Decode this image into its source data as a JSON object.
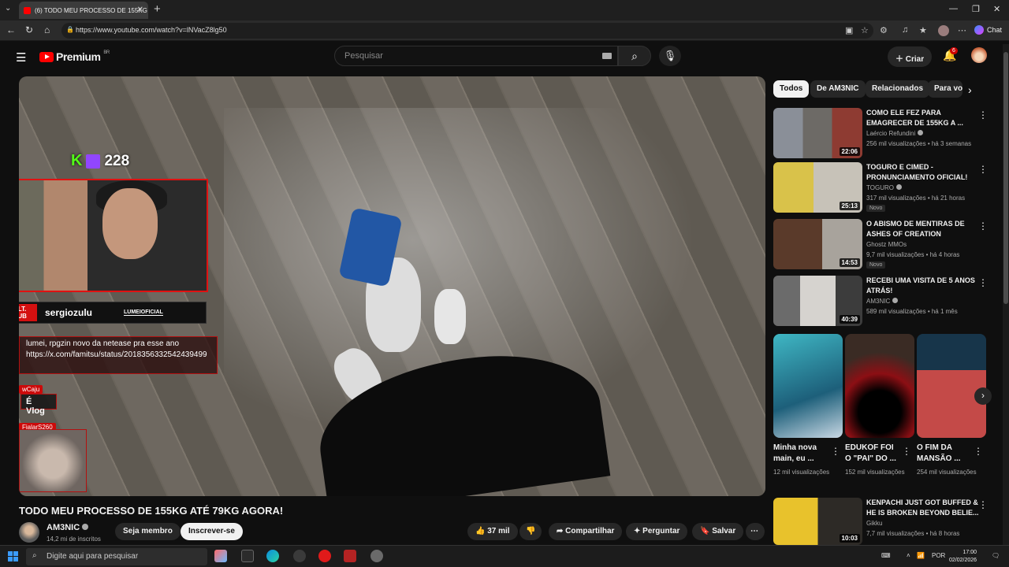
{
  "browser": {
    "tab_title": "(6) TODO MEU PROCESSO DE 155KG",
    "url": "https://www.youtube.com/watch?v=lNVacZ8lg50",
    "chat_label": "Chat"
  },
  "header": {
    "logo_text": "Premium",
    "logo_region": "BR",
    "search_placeholder": "Pesquisar",
    "create_label": "Criar",
    "notif_count": "6"
  },
  "overlay": {
    "counter": "228",
    "ult_label": "ULT. SUB",
    "username": "sergiozulu",
    "brand": "LUMEIOFICIAL",
    "msg1": "lumei, rpgzin novo da netease pra esse ano https://x.com/famitsu/status/2018356332542439499",
    "user2": "wCaju",
    "msg2": "É Vlog",
    "user3": "FjalarS260"
  },
  "video": {
    "title": "TODO MEU PROCESSO DE 155KG ATÉ 79KG AGORA!",
    "channel": "AM3NIC",
    "subscribers": "14,2 mi de inscritos",
    "member_label": "Seja membro",
    "subscribe_label": "Inscrever-se",
    "likes": "37 mil",
    "share_label": "Compartilhar",
    "ask_label": "Perguntar",
    "save_label": "Salvar"
  },
  "chips": [
    "Todos",
    "De AM3NIC",
    "Relacionados",
    "Para você"
  ],
  "recommendations": [
    {
      "title": "COMO ELE FEZ PARA EMAGRECER DE 155KG A ...",
      "channel": "Laércio Refundini",
      "meta": "256 mil visualizações • há 3 semanas",
      "duration": "22:06",
      "badge": ""
    },
    {
      "title": "TOGURO E CIMED - PRONUNCIAMENTO OFICIAL!",
      "channel": "TOGURO",
      "meta": "317 mil visualizações • há 21 horas",
      "duration": "25:13",
      "badge": "Novo"
    },
    {
      "title": "O ABISMO DE MENTIRAS DE ASHES OF CREATION",
      "channel": "Ghostz MMOs",
      "meta": "9,7 mil visualizações • há 4 horas",
      "duration": "14:53",
      "badge": "Novo"
    },
    {
      "title": "RECEBI UMA VISITA DE 5 ANOS ATRÁS!",
      "channel": "AM3NIC",
      "meta": "589 mil visualizações • há 1 mês",
      "duration": "40:39",
      "badge": ""
    }
  ],
  "shorts": [
    {
      "title": "Minha nova main, eu ...",
      "views": "12 mil visualizações"
    },
    {
      "title": "EDUKOF FOI O \"PAI\" DO ...",
      "views": "152 mil visualizações"
    },
    {
      "title": "O FIM DA MANSÃO ...",
      "views": "254 mil visualizações"
    }
  ],
  "rec_bottom": {
    "title": "KENPACHI JUST GOT BUFFED & HE IS BROKEN BEYOND BELIE...",
    "channel": "Gikku",
    "meta": "7,7 mil visualizações • há 8 horas",
    "duration": "10:03"
  },
  "taskbar": {
    "search_placeholder": "Digite aqui para pesquisar",
    "lang": "POR",
    "time": "17:00",
    "date": "02/02/2026"
  }
}
